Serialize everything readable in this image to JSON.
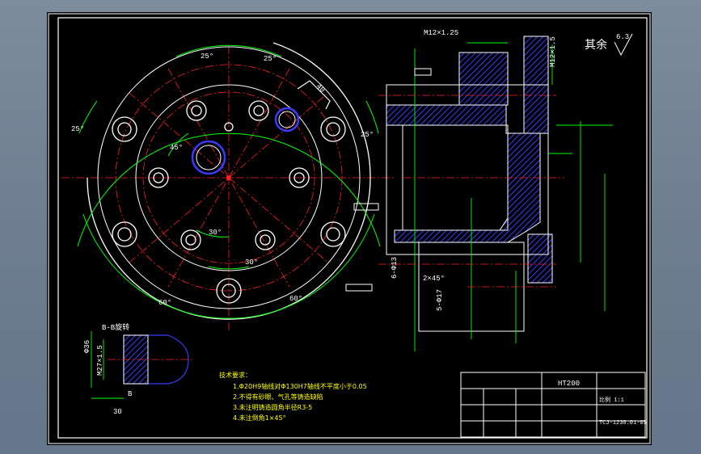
{
  "roughness": {
    "label": "其余",
    "value": "6.3"
  },
  "plan_view": {
    "angles": {
      "top_left": "25°",
      "top_right": "25°",
      "left": "25°",
      "right": "25°",
      "inner_45": "45°",
      "lower_30": "30°",
      "bottom_30": "30°",
      "bottom_left_60": "60°",
      "bottom_right_60": "60°"
    },
    "notch_dim": "40"
  },
  "section_view": {
    "thread_top": "M12×1.25",
    "thread_right": "M12×1.5",
    "holes_left": "6-Φ13",
    "chamfer": "2×45°",
    "holes_bottom": "5-Φ17"
  },
  "section_bb": {
    "title": "B-B旋转",
    "dim_36": "Φ36",
    "dim_27": "M27×1.5",
    "dim_30": "30",
    "label_b": "B"
  },
  "tech_req": {
    "title": "技术要求：",
    "items": [
      "1.Φ20H9轴线对Φ130H7轴线不平度小于0.05",
      "2.不得有砂眼、气孔等铸造缺陷",
      "3.未注明铸造圆角半径R3-5",
      "4.未注倒角1×45°"
    ]
  },
  "title_block": {
    "material": "HT200",
    "scale": "比例 1:1",
    "drawing_no": "TCJ-1230.01-05"
  },
  "colors": {
    "cyan": "#00ffff",
    "red": "#ff2020",
    "blue": "#3a3aff",
    "yellow": "#ffff00",
    "green": "#00ff00",
    "white": "#ffffff",
    "magenta": "#ff00ff"
  }
}
